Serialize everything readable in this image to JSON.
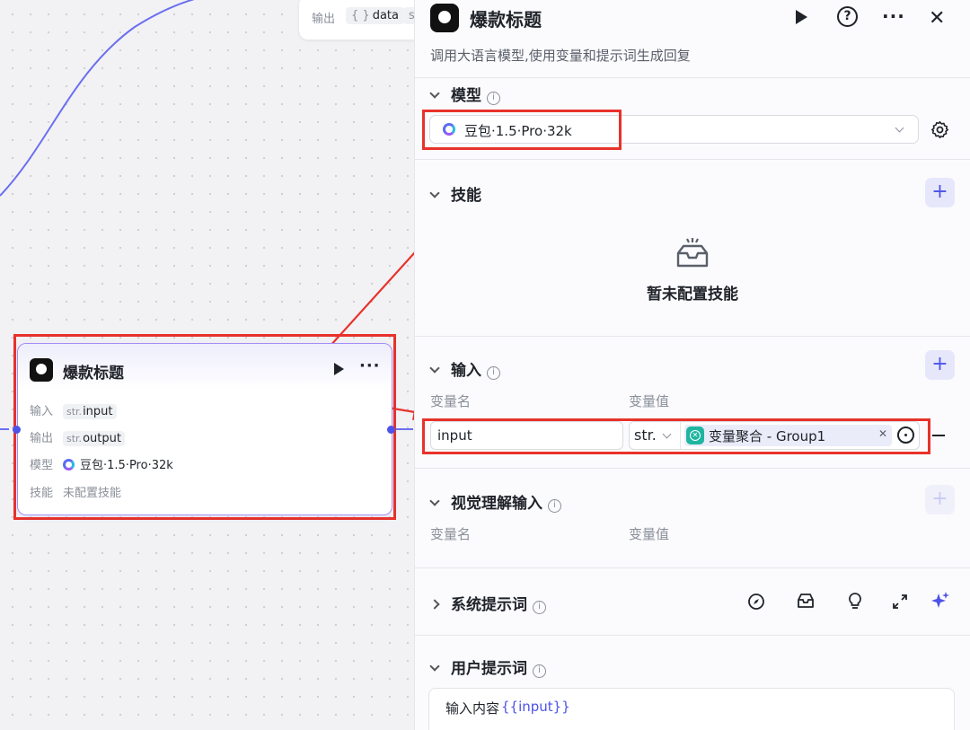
{
  "canvas": {
    "top_node": {
      "output_label": "输出",
      "output_type": "{ }",
      "output_name": "data",
      "output_extra": "str"
    },
    "node": {
      "title": "爆款标题",
      "input_label": "输入",
      "input_type": "str.",
      "input_name": "input",
      "output_label": "输出",
      "output_type": "str.",
      "output_name": "output",
      "model_label": "模型",
      "model_value": "豆包·1.5·Pro·32k",
      "skills_label": "技能",
      "skills_value": "未配置技能"
    }
  },
  "panel": {
    "title": "爆款标题",
    "description": "调用大语言模型,使用变量和提示词生成回复",
    "model": {
      "label": "模型",
      "value": "豆包·1.5·Pro·32k"
    },
    "skills": {
      "label": "技能",
      "empty_text": "暂未配置技能"
    },
    "input": {
      "label": "输入",
      "col_name": "变量名",
      "col_value": "变量值",
      "var_name": "input",
      "var_type": "str.",
      "var_ref": "变量聚合 - Group1"
    },
    "vision": {
      "label": "视觉理解输入",
      "col_name": "变量名",
      "col_value": "变量值"
    },
    "system_prompt": {
      "label": "系统提示词"
    },
    "user_prompt": {
      "label": "用户提示词",
      "text": "输入内容",
      "var": "{{input}}"
    }
  },
  "colors": {
    "accent": "#4d53e8",
    "highlight": "#e8322b",
    "edge": "#6b6ff0"
  }
}
